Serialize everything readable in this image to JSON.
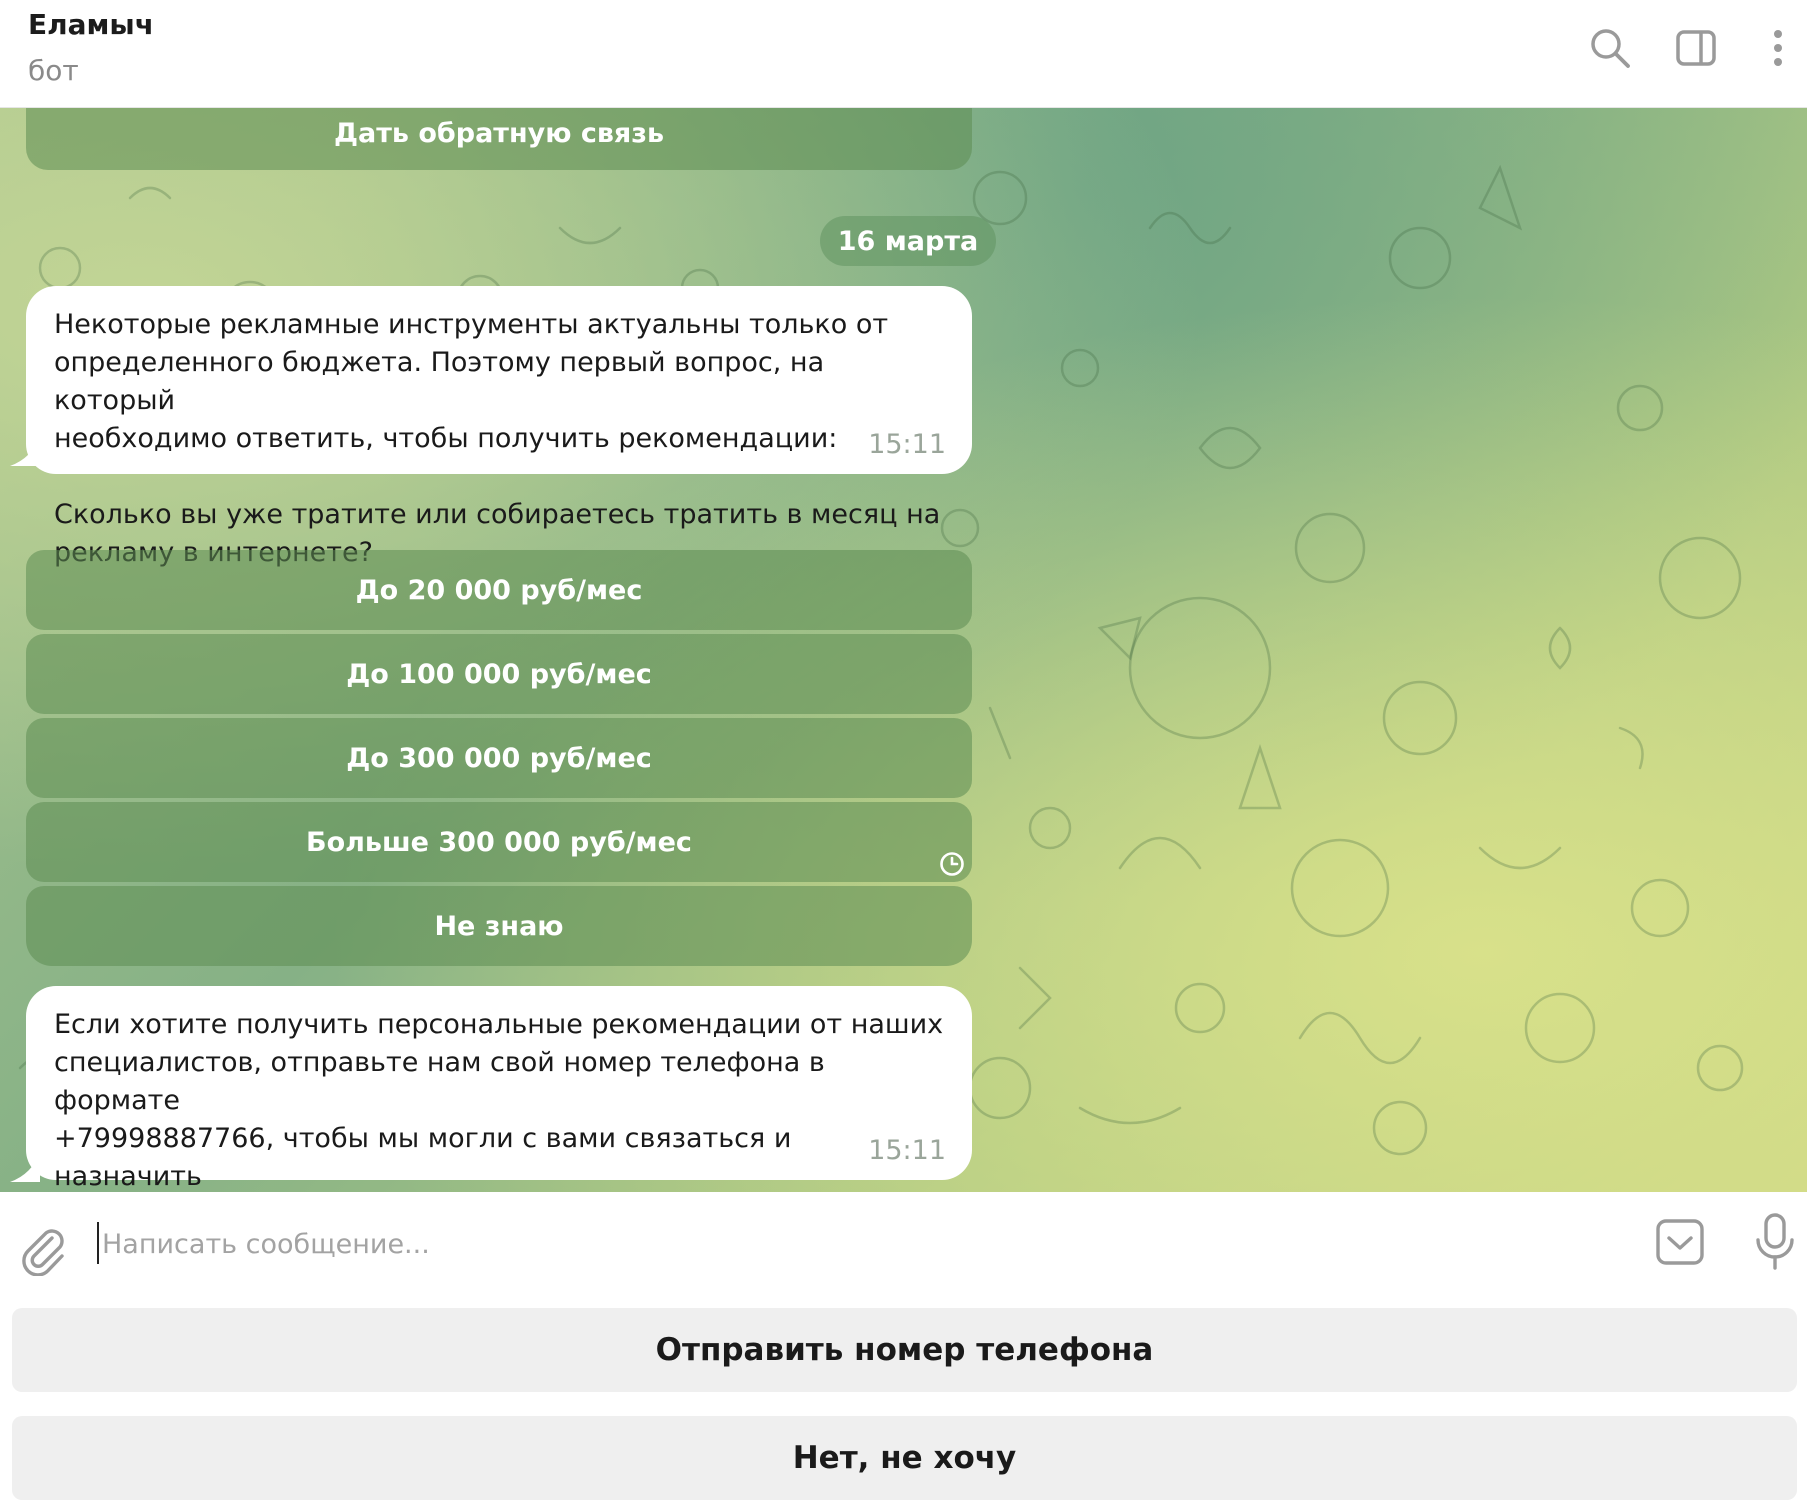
{
  "header": {
    "title": "Еламыч",
    "subtitle": "бот",
    "icons": [
      "search-icon",
      "sidebar-toggle-icon",
      "more-vertical-icon"
    ]
  },
  "chat": {
    "top_button": "Дать обратную связь",
    "date_divider": "16 марта",
    "messages": [
      {
        "text": "Некоторые рекламные инструменты актуальны только от\nопределенного бюджета. Поэтому первый вопрос, на который\nнеобходимо ответить, чтобы получить рекомендации:\n\nСколько вы уже тратите или собираетесь тратить в месяц на\nрекламу в интернете?",
        "time": "15:11"
      },
      {
        "text": "Если хотите получить персональные рекомендации от наших\nспециалистов, отправьте нам свой номер телефона в формате\n+79998887766, чтобы мы могли с вами связаться и назначить\nудобное для вас время консультации.",
        "time": "15:11"
      }
    ],
    "inline_buttons": [
      "До 20 000 руб/мес",
      "До 100 000 руб/мес",
      "До 300 000 руб/мес",
      "Больше 300 000 руб/мес",
      "Не знаю"
    ],
    "pending_icon": "clock-icon"
  },
  "composer": {
    "placeholder": "Написать сообщение...",
    "value": "",
    "icons": [
      "paperclip-icon",
      "keyboard-icon",
      "microphone-icon"
    ]
  },
  "reply_keyboard": {
    "buttons": [
      "Отправить номер телефона",
      "Нет, не хочу"
    ]
  },
  "colors": {
    "inline_button_bg": "#5c8c52",
    "bubble_bg": "#ffffff",
    "reply_button_bg": "#efefef",
    "time_color": "#9aa59a"
  }
}
